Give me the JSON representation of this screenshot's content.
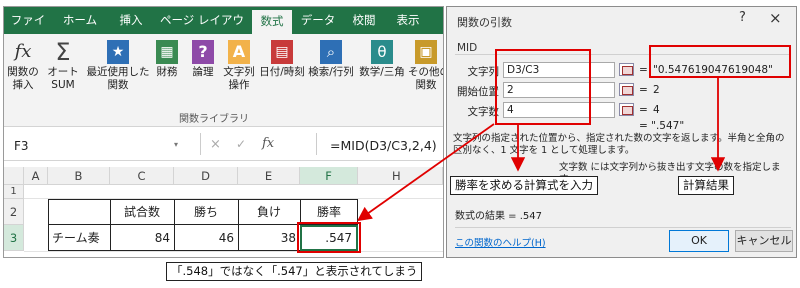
{
  "excel": {
    "tabs": [
      "ファイル",
      "ホーム",
      "挿入",
      "ページ レイアウト",
      "数式",
      "データ",
      "校閲",
      "表示"
    ],
    "ribbon_buttons": [
      {
        "label": "関数の\n挿入",
        "icon": "insert-function-icon",
        "glyph": "fx"
      },
      {
        "label": "オート\nSUM",
        "icon": "autosum-icon",
        "glyph": "Σ",
        "dropdown": true
      },
      {
        "label": "最近使用した\n関数",
        "icon": "recent-functions-icon",
        "glyph": "★",
        "dropdown": true
      },
      {
        "label": "財務",
        "icon": "financial-icon",
        "glyph": "▦",
        "dropdown": true
      },
      {
        "label": "論理",
        "icon": "logical-icon",
        "glyph": "?",
        "dropdown": true
      },
      {
        "label": "文字列\n操作",
        "icon": "text-icon",
        "glyph": "A",
        "dropdown": true
      },
      {
        "label": "日付/時刻",
        "icon": "date-time-icon",
        "glyph": "▤",
        "dropdown": true
      },
      {
        "label": "検索/行列",
        "icon": "lookup-icon",
        "glyph": "⌕",
        "dropdown": true
      },
      {
        "label": "数学/三角",
        "icon": "math-trig-icon",
        "glyph": "θ",
        "dropdown": true
      },
      {
        "label": "その他の\n関数",
        "icon": "more-functions-icon",
        "glyph": "▣",
        "dropdown": true
      }
    ],
    "group_label": "関数ライブラリ",
    "name_box": "F3",
    "fx_symbol": "fx",
    "formula": "=MID(D3/C3,2,4)",
    "columns": [
      "A",
      "B",
      "C",
      "D",
      "E",
      "F",
      "H"
    ],
    "rows": [
      "1",
      "2",
      "3"
    ],
    "headers_row": [
      "",
      "試合数",
      "勝ち",
      "負け",
      "勝率"
    ],
    "data_row": [
      "チーム奏",
      "84",
      "46",
      "38",
      ".547"
    ]
  },
  "dialog": {
    "title": "関数の引数",
    "help": "?",
    "close": "×",
    "function_name": "MID",
    "args": [
      {
        "label": "文字列",
        "value": "D3/C3",
        "result": "\"0.547619047619048\""
      },
      {
        "label": "開始位置",
        "value": "2",
        "result": "2"
      },
      {
        "label": "文字数",
        "value": "4",
        "result": "4"
      }
    ],
    "formula_result_preview": "= \".547\"",
    "description": "文字列の指定された位置から、指定された数の文字を返します。半角と全角の区別なく、1 文字を 1 として処理します。",
    "arg_description": "文字数  には文字列から抜き出す文字の数を指定します。",
    "result_label": "数式の結果 =  .547",
    "help_link": "この関数のヘルプ(H)",
    "ok": "OK",
    "cancel": "キャンセル"
  },
  "callouts": {
    "formula_note": "勝率を求める計算式を入力",
    "result_note": "計算結果",
    "bottom_note": "「.548」ではなく「.547」と表示されてしまう"
  },
  "colors": {
    "excel_green": "#217346",
    "highlight_red": "#e00000"
  }
}
